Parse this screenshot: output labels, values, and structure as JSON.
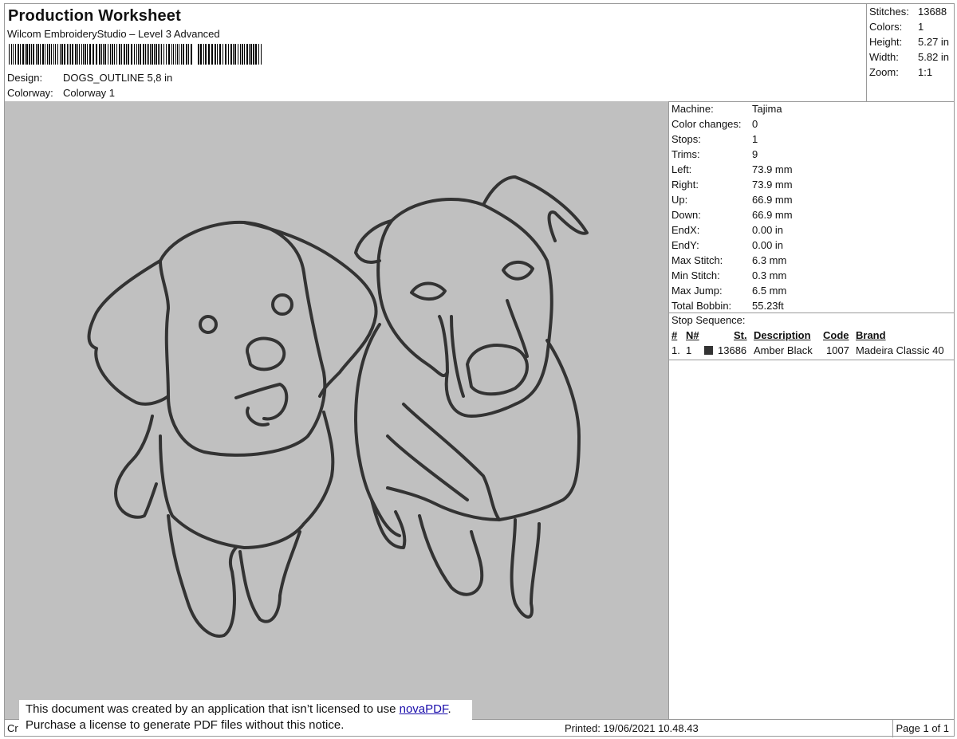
{
  "header": {
    "title": "Production Worksheet",
    "subtitle": "Wilcom EmbroideryStudio – Level 3 Advanced",
    "design_label": "Design:",
    "design_value": "DOGS_OUTLINE 5,8 in",
    "colorway_label": "Colorway:",
    "colorway_value": "Colorway 1"
  },
  "summary": {
    "stitches_label": "Stitches:",
    "stitches_value": "13688",
    "colors_label": "Colors:",
    "colors_value": "1",
    "height_label": "Height:",
    "height_value": "5.27 in",
    "width_label": "Width:",
    "width_value": "5.82 in",
    "zoom_label": "Zoom:",
    "zoom_value": "1:1"
  },
  "machine_info": [
    {
      "label": "Machine:",
      "value": "Tajima"
    },
    {
      "label": "Color changes:",
      "value": "0"
    },
    {
      "label": "Stops:",
      "value": "1"
    },
    {
      "label": "Trims:",
      "value": "9"
    },
    {
      "label": "Left:",
      "value": "73.9 mm"
    },
    {
      "label": "Right:",
      "value": "73.9 mm"
    },
    {
      "label": "Up:",
      "value": "66.9 mm"
    },
    {
      "label": "Down:",
      "value": "66.9 mm"
    },
    {
      "label": "EndX:",
      "value": "0.00 in"
    },
    {
      "label": "EndY:",
      "value": "0.00 in"
    },
    {
      "label": "Max Stitch:",
      "value": "6.3 mm"
    },
    {
      "label": "Min Stitch:",
      "value": "0.3 mm"
    },
    {
      "label": "Max Jump:",
      "value": "6.5 mm"
    },
    {
      "label": "Total Bobbin:",
      "value": "55.23ft"
    }
  ],
  "stop_sequence": {
    "title": "Stop Sequence:",
    "columns": {
      "hash": "#",
      "n": "N#",
      "st": "St.",
      "description": "Description",
      "code": "Code",
      "brand": "Brand"
    },
    "rows": [
      {
        "hash": "1.",
        "n": "1",
        "st": "13686",
        "description": "Amber Black",
        "code": "1007",
        "brand": "Madeira Classic 40",
        "color": "#333333"
      }
    ]
  },
  "footer": {
    "left_text": "Cr",
    "printed": "Printed: 19/06/2021 10.48.43",
    "page": "Page 1 of 1"
  },
  "notice": {
    "line1_prefix": "This document was created by an application that isn’t licensed to use ",
    "link": "novaPDF",
    "line1_suffix": ".",
    "line2": "Purchase a license to generate PDF files without this notice."
  },
  "colors": {
    "canvas_bg": "#c0c0c0",
    "thread": "#333333"
  }
}
